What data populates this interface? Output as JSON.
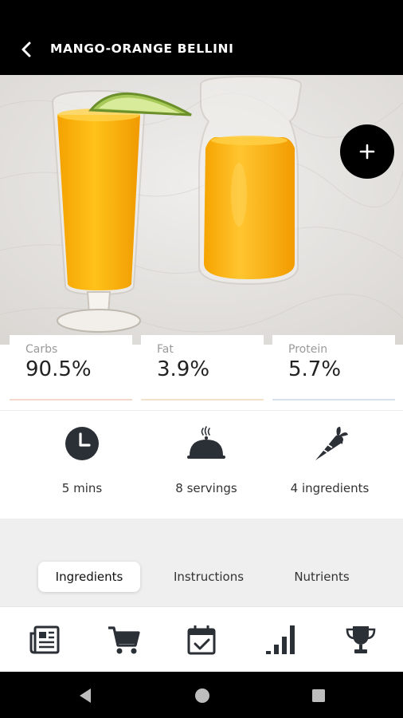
{
  "header": {
    "title": "MANGO-ORANGE BELLINI",
    "back_icon": "chevron-left-icon",
    "add_icon": "plus-icon"
  },
  "hero": {
    "image_subject": "glass and carafe of mango-orange juice with lime slice"
  },
  "macros": [
    {
      "label": "Carbs",
      "value": "90.5%"
    },
    {
      "label": "Fat",
      "value": "3.9%"
    },
    {
      "label": "Protein",
      "value": "5.7%"
    }
  ],
  "stats": [
    {
      "icon": "clock-icon",
      "label": "5 mins"
    },
    {
      "icon": "serving-dish-icon",
      "label": "8 servings"
    },
    {
      "icon": "carrot-icon",
      "label": "4 ingredients"
    }
  ],
  "tabs": [
    {
      "label": "Ingredients",
      "active": true
    },
    {
      "label": "Instructions",
      "active": false
    },
    {
      "label": "Nutrients",
      "active": false
    }
  ],
  "bottom_nav": [
    {
      "icon": "newspaper-icon"
    },
    {
      "icon": "cart-icon"
    },
    {
      "icon": "calendar-check-icon"
    },
    {
      "icon": "bar-chart-icon"
    },
    {
      "icon": "trophy-icon"
    }
  ],
  "system_nav": [
    {
      "icon": "back-triangle-icon"
    },
    {
      "icon": "home-circle-icon"
    },
    {
      "icon": "recents-square-icon"
    }
  ],
  "colors": {
    "bar": "#000000",
    "icon_dark": "#2b2f36",
    "segment_bg": "#efefef",
    "juice": "#f5a60e"
  }
}
